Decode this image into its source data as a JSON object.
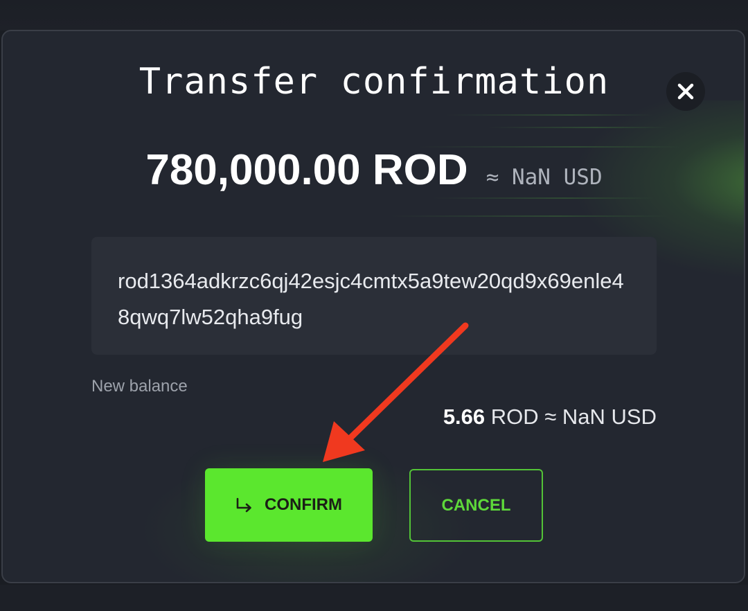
{
  "modal": {
    "title": "Transfer confirmation",
    "close_icon": "close-icon"
  },
  "transfer": {
    "amount": "780,000.00 ROD",
    "amount_usd": "≈ NaN USD",
    "recipient_address": "rod1364adkrzc6qj42esjc4cmtx5a9tew20qd9x69enle48qwq7lw52qha9fug"
  },
  "balance": {
    "label": "New balance",
    "value": "5.66",
    "suffix": "ROD ≈ NaN USD"
  },
  "actions": {
    "confirm_label": "CONFIRM",
    "confirm_icon": "return-arrow-icon",
    "cancel_label": "CANCEL"
  },
  "colors": {
    "accent": "#5be72e",
    "background": "#232730",
    "annotation_arrow": "#f0391f"
  }
}
